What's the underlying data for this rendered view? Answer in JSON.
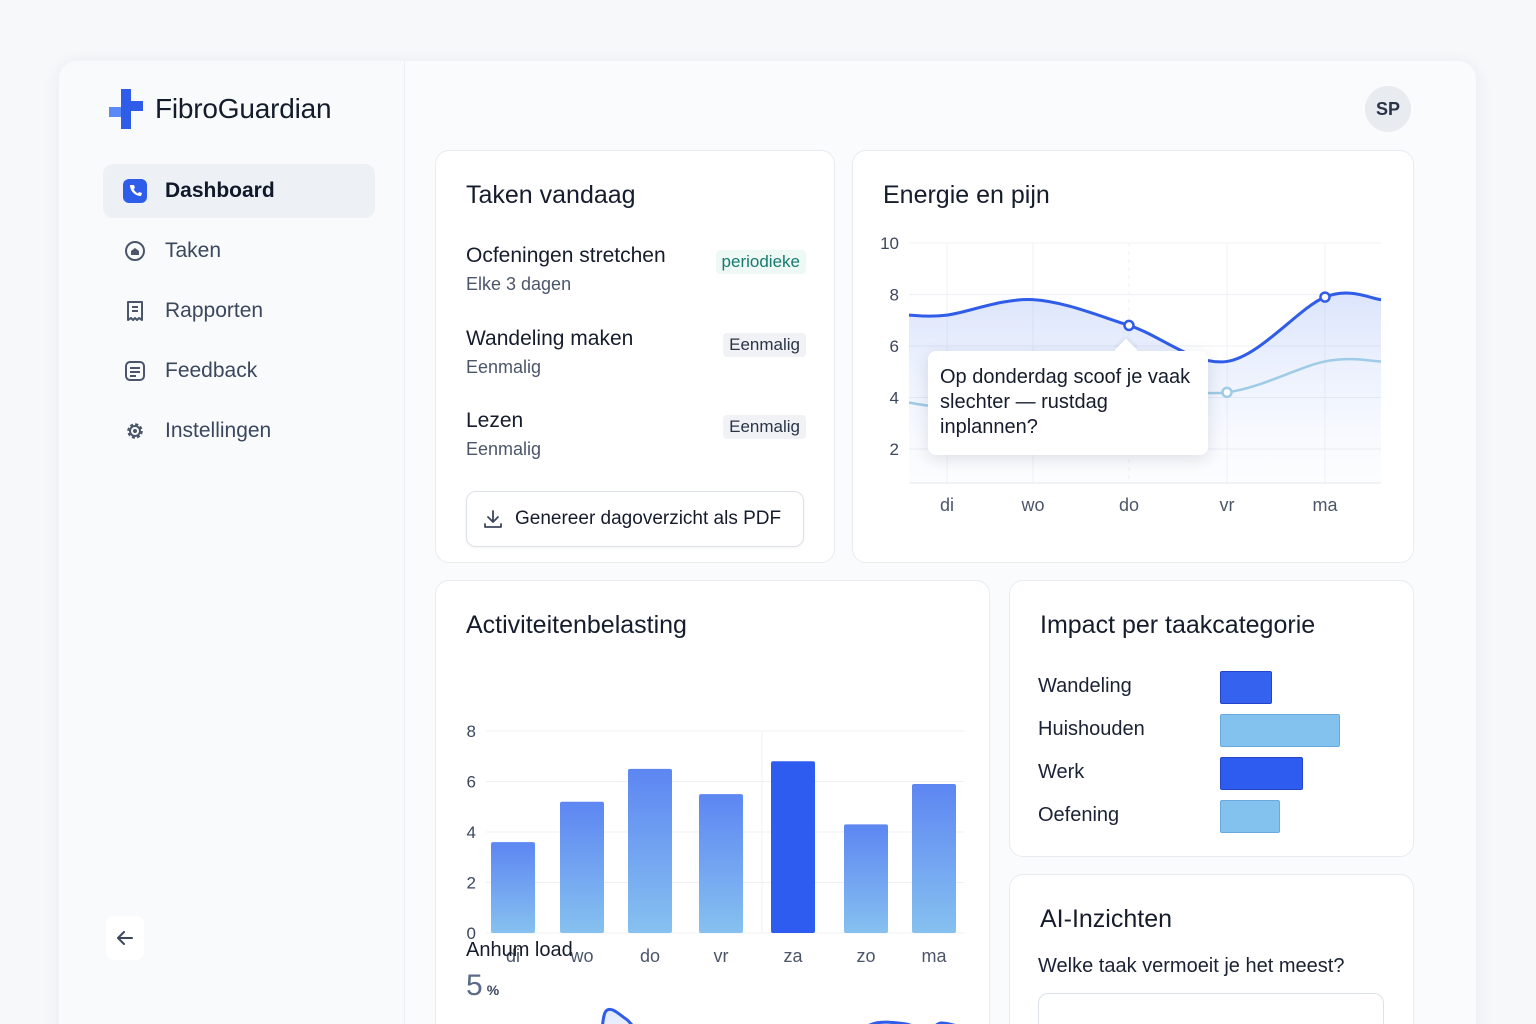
{
  "brand": {
    "name": "FibroGuardian"
  },
  "user": {
    "initials": "SP"
  },
  "sidebar": {
    "items": [
      {
        "label": "Dashboard",
        "icon": "phone-icon",
        "active": true
      },
      {
        "label": "Taken",
        "icon": "home-circle-icon"
      },
      {
        "label": "Rapporten",
        "icon": "receipt-icon"
      },
      {
        "label": "Feedback",
        "icon": "document-icon"
      },
      {
        "label": "Instellingen",
        "icon": "gear-icon"
      }
    ]
  },
  "tasks": {
    "title": "Taken vandaag",
    "items": [
      {
        "name": "Ocfeningen stretchen",
        "sub": "Elke 3 dagen",
        "tag": "periodieke"
      },
      {
        "name": "Wandeling maken",
        "sub": "Eenmalig",
        "tag": "Eenmalig"
      },
      {
        "name": "Lezen",
        "sub": "Eenmalig",
        "tag": "Eenmalig"
      }
    ],
    "pdf_button": "Genereer dagoverzicht als PDF"
  },
  "energy": {
    "title": "Energie en pijn",
    "tooltip": "Op donderdag scoof je vaak slechter — rustdag inplannen?"
  },
  "activity": {
    "title": "Activiteitenbelasting",
    "load_label": "Anhum load",
    "load_value": "5",
    "load_unit": "%"
  },
  "impact": {
    "title": "Impact per taakcategorie",
    "items": [
      {
        "label": "Wandeling",
        "value": 1.0,
        "color": "#3563f0"
      },
      {
        "label": "Huishouden",
        "value": 2.3,
        "color": "#83c1ef"
      },
      {
        "label": "Werk",
        "value": 1.6,
        "color": "#2f5cf0"
      },
      {
        "label": "Oefening",
        "value": 1.15,
        "color": "#83c1ef"
      }
    ]
  },
  "ai": {
    "title": "AI-Inzichten",
    "question": "Welke taak vermoeit je het meest?"
  },
  "chart_data": [
    {
      "type": "line",
      "title": "Energie en pijn",
      "categories": [
        "di",
        "wo",
        "do",
        "vr",
        "ma"
      ],
      "ylim": [
        0,
        10
      ],
      "yticks": [
        2,
        4,
        6,
        8,
        10
      ],
      "series": [
        {
          "values": [
            7.2,
            7.8,
            6.8,
            5.4,
            7.9
          ],
          "color": "#2f5ce8"
        },
        {
          "values": [
            3.7,
            4.3,
            4.5,
            4.2,
            5.4
          ],
          "color": "#9fcbe6"
        }
      ],
      "grid": true
    },
    {
      "type": "bar",
      "title": "Activiteitenbelasting",
      "categories": [
        "di",
        "wo",
        "do",
        "vr",
        "za",
        "zo",
        "ma"
      ],
      "values": [
        3.6,
        5.2,
        6.5,
        5.5,
        6.8,
        4.3,
        5.9
      ],
      "highlight": "za",
      "ylim": [
        0,
        8
      ],
      "yticks": [
        0,
        2,
        4,
        6,
        8
      ],
      "grid": true
    }
  ]
}
